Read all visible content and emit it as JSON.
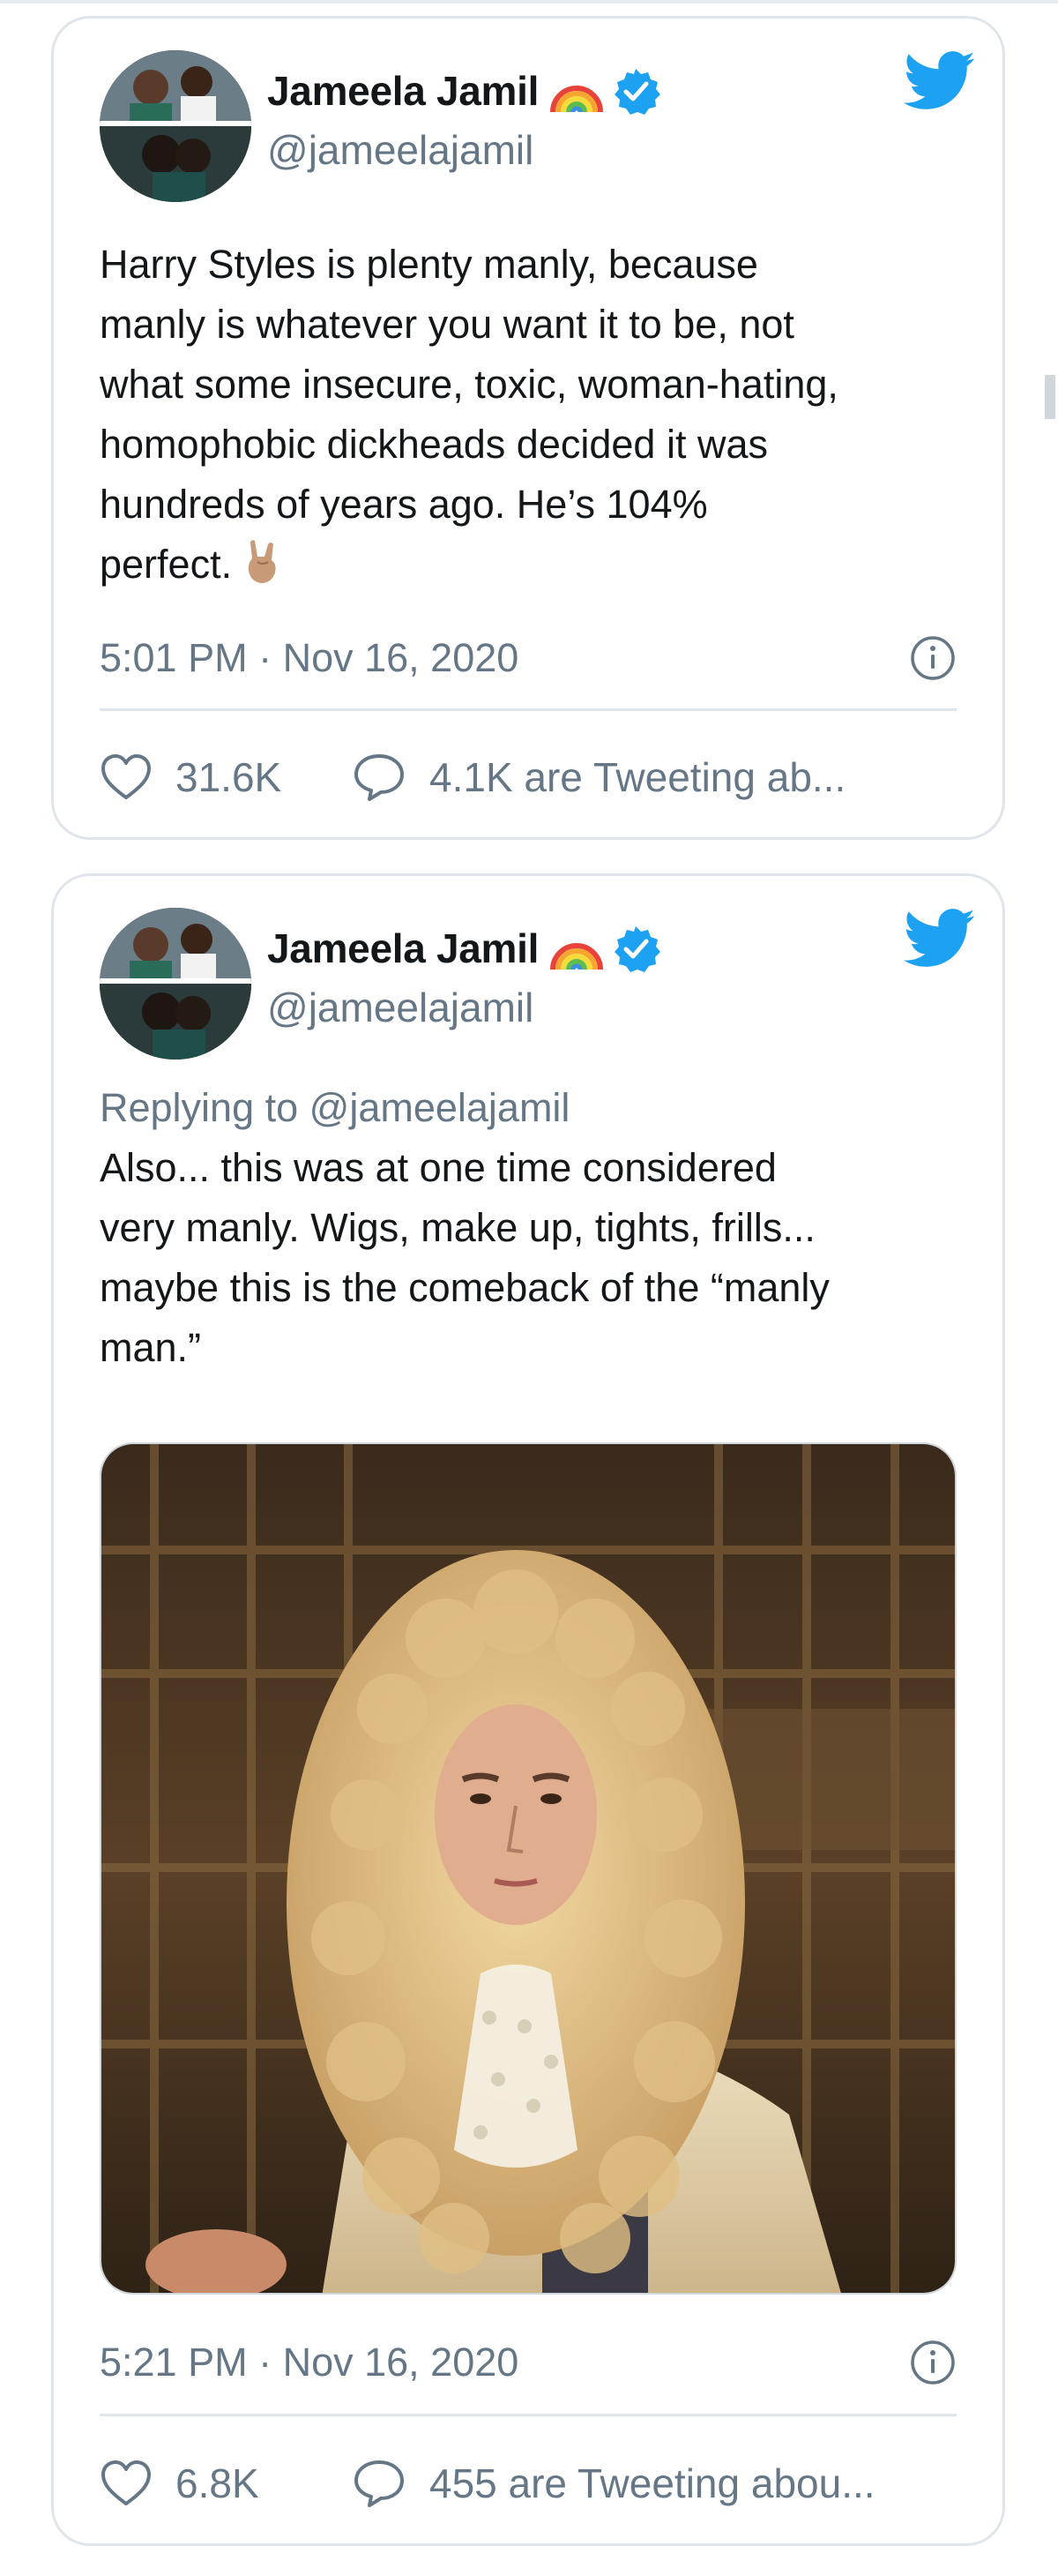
{
  "tweets": [
    {
      "author": {
        "name": "Jameela Jamil",
        "handle": "@jameelajamil",
        "verified": true,
        "badge_emoji": "rainbow"
      },
      "text": "Harry Styles is plenty manly, because\nmanly is whatever you want it to be, not\nwhat some insecure, toxic, woman-hating,\nhomophobic  dickheads decided it was\nhundreds of years ago. He’s 104%\nperfect.",
      "emoji": "sign-of-the-horns",
      "time": "5:01 PM · Nov 16, 2020",
      "likes": "31.6K",
      "conversation": "4.1K are Tweeting ab..."
    },
    {
      "author": {
        "name": "Jameela Jamil",
        "handle": "@jameelajamil",
        "verified": true,
        "badge_emoji": "rainbow"
      },
      "reply_prefix": "Replying to",
      "reply_handle": "@jameelajamil",
      "text": "Also... this was at one time considered\nvery manly. Wigs, make up, tights, frills...\nmaybe this is the comeback of the “manly\nman.”",
      "media": "photo-man-in-curly-wig",
      "time": "5:21 PM · Nov 16, 2020",
      "likes": "6.8K",
      "conversation": "455 are Tweeting abou..."
    }
  ],
  "colors": {
    "text": "#14171a",
    "secondary": "#657786",
    "twitter_blue": "#1da1f2",
    "border": "#dfe5ea"
  },
  "icons": [
    "avatar",
    "rainbow-icon",
    "verified-badge-icon",
    "twitter-bird-icon",
    "info-icon",
    "heart-icon",
    "reply-bubble-icon"
  ]
}
